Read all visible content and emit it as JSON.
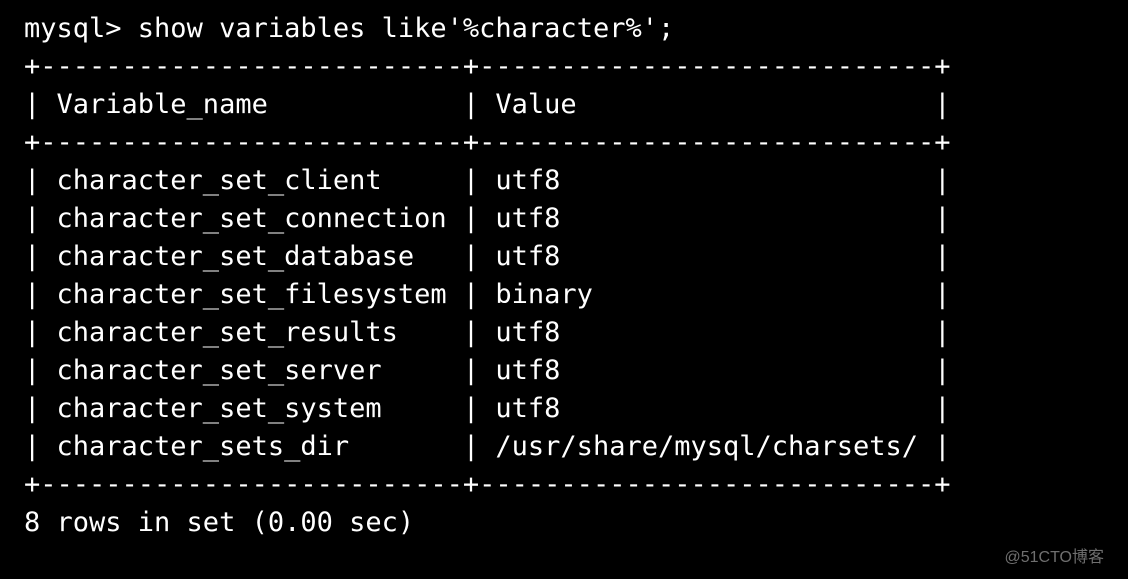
{
  "prompt_prefix": "mysql> ",
  "query": "show variables like'%character%';",
  "border_top": "+--------------------------+----------------------------+",
  "header_row": "| Variable_name            | Value                      |",
  "border_mid": "+--------------------------+----------------------------+",
  "data_rows": [
    "| character_set_client     | utf8                       |",
    "| character_set_connection | utf8                       |",
    "| character_set_database   | utf8                       |",
    "| character_set_filesystem | binary                     |",
    "| character_set_results    | utf8                       |",
    "| character_set_server     | utf8                       |",
    "| character_set_system     | utf8                       |",
    "| character_sets_dir       | /usr/share/mysql/charsets/ |"
  ],
  "border_bot": "+--------------------------+----------------------------+",
  "status": "8 rows in set (0.00 sec)",
  "columns": [
    "Variable_name",
    "Value"
  ],
  "table": [
    {
      "Variable_name": "character_set_client",
      "Value": "utf8"
    },
    {
      "Variable_name": "character_set_connection",
      "Value": "utf8"
    },
    {
      "Variable_name": "character_set_database",
      "Value": "utf8"
    },
    {
      "Variable_name": "character_set_filesystem",
      "Value": "binary"
    },
    {
      "Variable_name": "character_set_results",
      "Value": "utf8"
    },
    {
      "Variable_name": "character_set_server",
      "Value": "utf8"
    },
    {
      "Variable_name": "character_set_system",
      "Value": "utf8"
    },
    {
      "Variable_name": "character_sets_dir",
      "Value": "/usr/share/mysql/charsets/"
    }
  ],
  "watermark": "@51CTO博客"
}
